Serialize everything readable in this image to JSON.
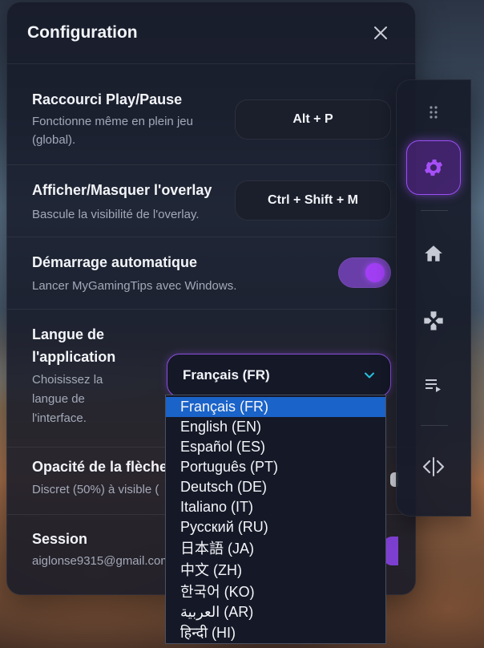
{
  "panel": {
    "title": "Configuration"
  },
  "settings": {
    "shortcut_play_pause": {
      "title": "Raccourci Play/Pause",
      "desc_line1": "Fonctionne même en plein jeu",
      "desc_line2": "(global).",
      "key": "Alt + P"
    },
    "shortcut_overlay": {
      "title": "Afficher/Masquer l'overlay",
      "desc": "Bascule la visibilité de l'overlay.",
      "key": "Ctrl + Shift + M"
    },
    "autostart": {
      "title": "Démarrage automatique",
      "desc": "Lancer MyGamingTips avec Windows.",
      "enabled": true
    },
    "language": {
      "title_line1": "Langue de",
      "title_line2": "l'application",
      "desc_line1": "Choisissez la",
      "desc_line2": "langue de",
      "desc_line3": "l'interface.",
      "selected": "Français (FR)",
      "options": [
        "Français (FR)",
        "English (EN)",
        "Español (ES)",
        "Português (PT)",
        "Deutsch (DE)",
        "Italiano (IT)",
        "Русский (RU)",
        "日本語 (JA)",
        "中文 (ZH)",
        "한국어 (KO)",
        "العربية (AR)",
        "हिन्दी (HI)"
      ]
    },
    "arrow_opacity": {
      "title": "Opacité de la flèche",
      "desc": "Discret (50%) à visible ("
    },
    "session": {
      "title": "Session",
      "email": "aiglonse9315@gmail.com"
    }
  },
  "colors": {
    "accent": "#9b4ff5",
    "selected_option": "#1a63c9",
    "panel_bg": "#161a28"
  },
  "rail": {
    "icons": [
      "drag-handle-icon",
      "gear-icon",
      "home-icon",
      "gamepad-icon",
      "playlist-icon",
      "code-icon"
    ]
  }
}
